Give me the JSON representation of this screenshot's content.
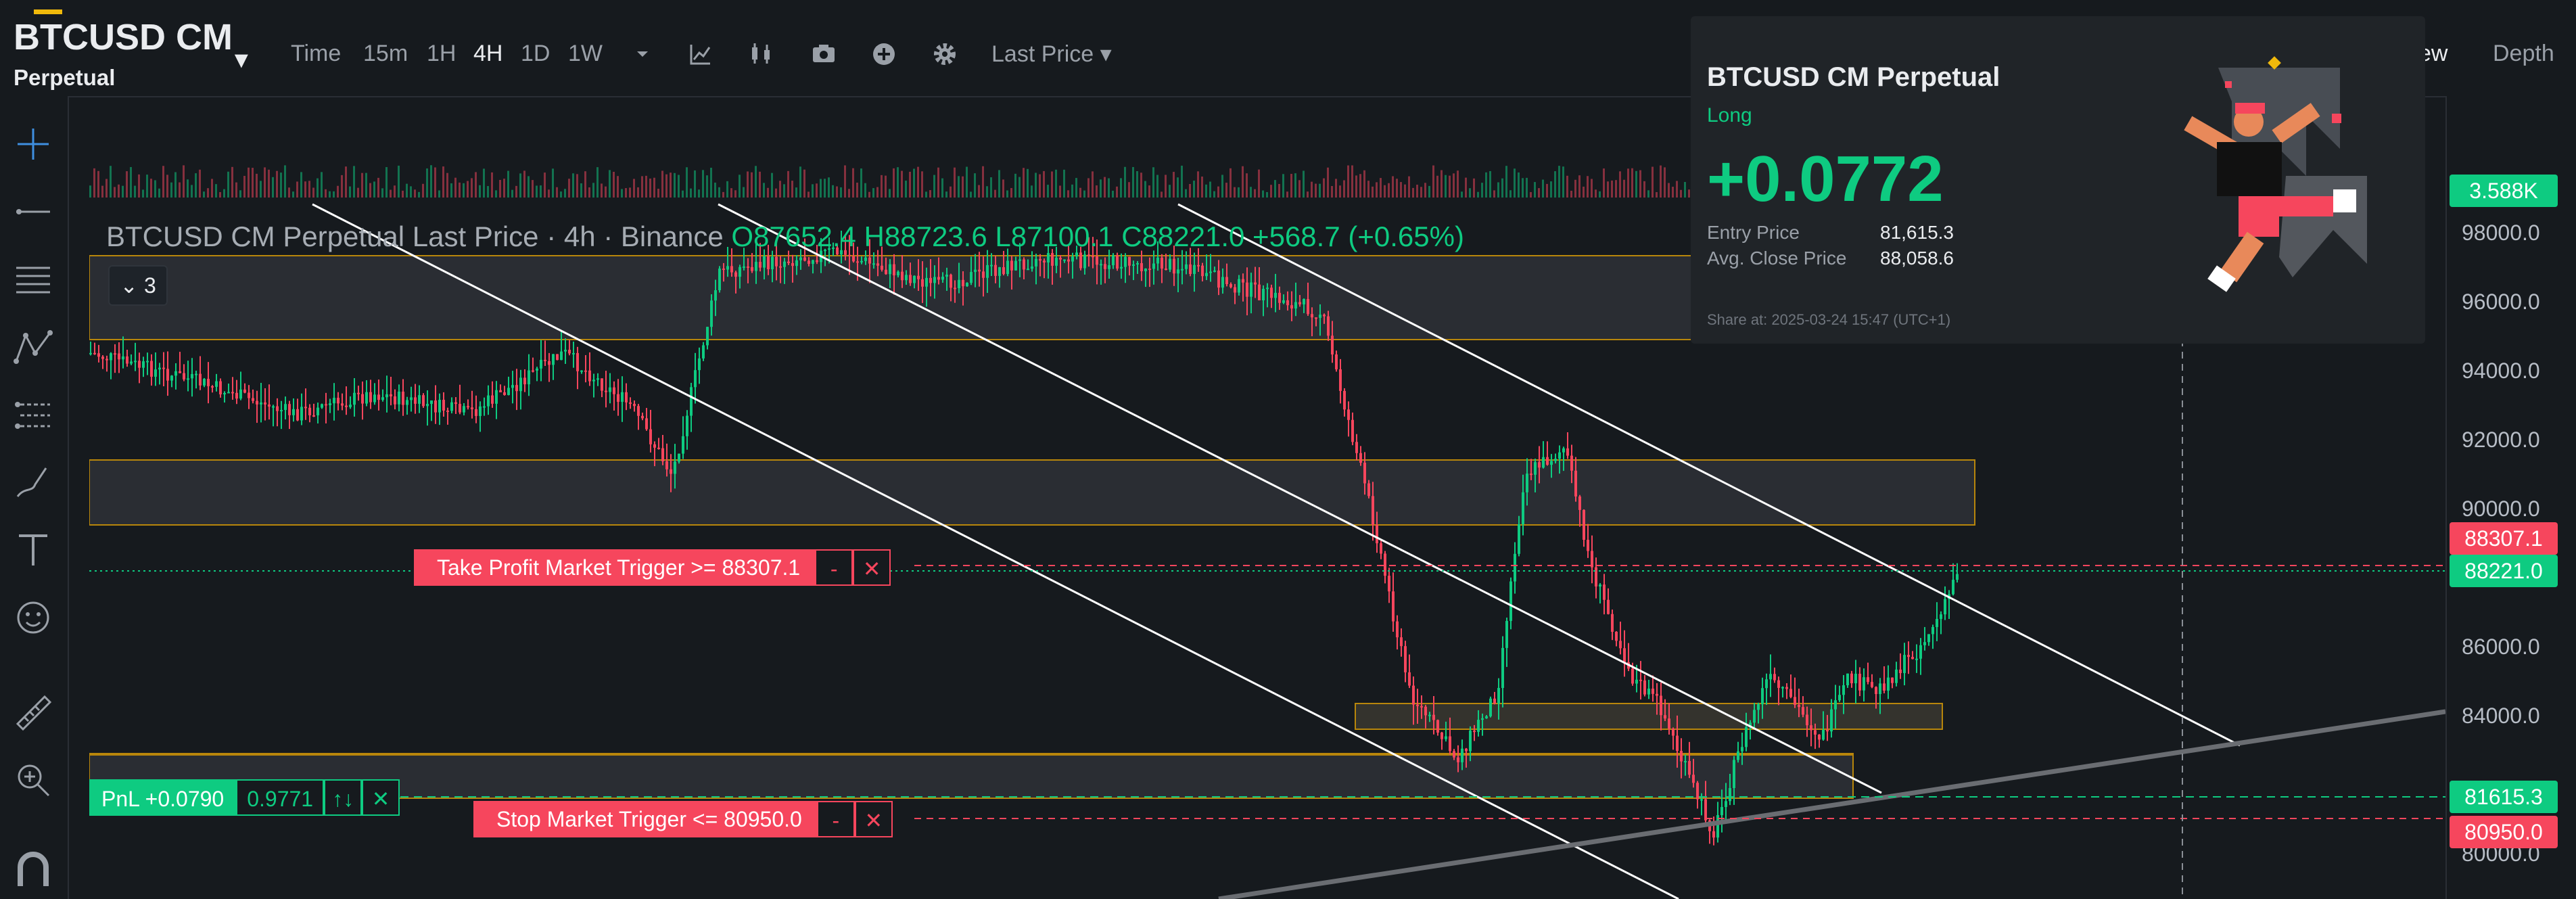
{
  "symbol": {
    "title": "BTCUSD CM",
    "subtitle": "Perpetual",
    "caret": "▼"
  },
  "toolbar": {
    "time_label": "Time",
    "intervals": [
      "15m",
      "1H",
      "4H",
      "1D",
      "1W"
    ],
    "active_interval": "4H",
    "price_type": "Last Price ▾",
    "icons": [
      "chevron-down-icon",
      "indicators-icon",
      "chart-style-icon",
      "camera-icon",
      "add-icon",
      "gear-icon"
    ]
  },
  "right_nav": {
    "view": "ew",
    "depth": "Depth"
  },
  "legend": {
    "name": "BTCUSD CM Perpetual Last Price · 4h · Binance",
    "open": "O87652.4",
    "high": "H88723.6",
    "low": "L87100.1",
    "close": "C88221.0",
    "change": "+568.7 (+0.65%)",
    "collapse_count": "3"
  },
  "price_axis": {
    "ticks": [
      "98000.0",
      "96000.0",
      "94000.0",
      "92000.0",
      "90000.0",
      "86000.0",
      "84000.0",
      "80000.0"
    ],
    "badges": {
      "volume": "3.588K",
      "take_profit": "88307.1",
      "last": "88221.0",
      "entry": "81615.3",
      "stop": "80950.0"
    }
  },
  "orders": {
    "take_profit_label": "Take Profit Market Trigger >= 88307.1",
    "stop_label": "Stop Market Trigger <= 80950.0",
    "minus": "-",
    "close": "✕"
  },
  "position": {
    "pnl_label": "PnL +0.0790",
    "qty": "0.9771",
    "reverse": "↑↓",
    "close": "✕"
  },
  "share_card": {
    "title": "BTCUSD CM Perpetual",
    "side": "Long",
    "pnl": "+0.0772",
    "entry_label": "Entry Price",
    "entry_value": "81,615.3",
    "close_label": "Avg. Close Price",
    "close_value": "88,058.6",
    "shared_at": "Share at: 2025-03-24 15:47 (UTC+1)"
  },
  "colors": {
    "up": "#0ecb81",
    "down": "#f6465d",
    "accent": "#f0b90b",
    "background": "#161a1e"
  }
}
